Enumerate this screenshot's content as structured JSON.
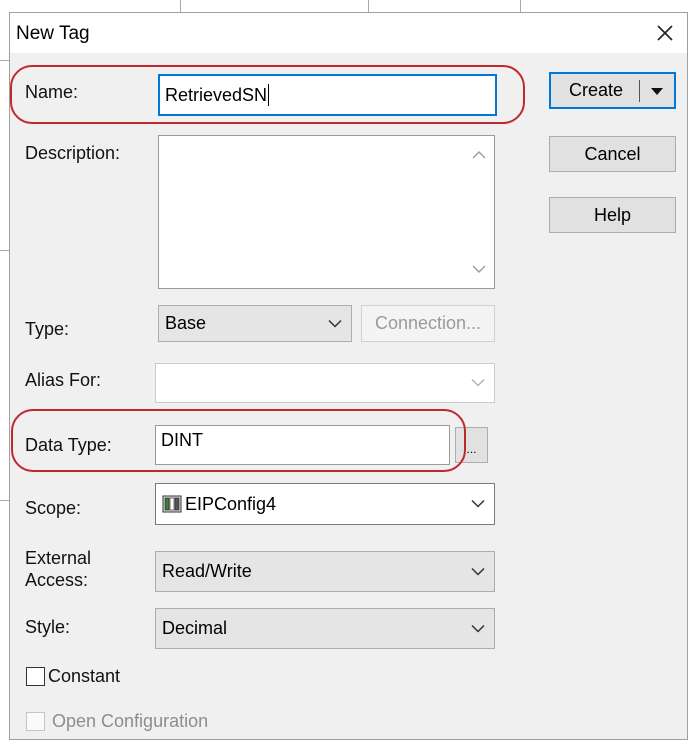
{
  "dialog": {
    "title": "New Tag",
    "close_glyph": "✕"
  },
  "name": {
    "label": "Name:",
    "value": "RetrievedSN"
  },
  "description": {
    "label": "Description:",
    "value": ""
  },
  "type": {
    "label": "Type:",
    "selected": "Base",
    "connection_button": "Connection..."
  },
  "alias_for": {
    "label": "Alias For:",
    "value": ""
  },
  "data_type": {
    "label": "Data Type:",
    "value": "DINT",
    "browse_button": "..."
  },
  "scope": {
    "label": "Scope:",
    "selected": "EIPConfig4",
    "icon": "controller-icon"
  },
  "external_access": {
    "label_line1": "External",
    "label_line2": "Access:",
    "selected": "Read/Write"
  },
  "style": {
    "label": "Style:",
    "selected": "Decimal"
  },
  "constant": {
    "label": "Constant",
    "checked": false
  },
  "open_configuration": {
    "label": "Open Configuration",
    "checked": false
  },
  "buttons": {
    "create": "Create",
    "cancel": "Cancel",
    "help": "Help"
  },
  "colors": {
    "highlight": "#c0282f",
    "focus_border": "#0078d7",
    "dialog_bg": "#f0f0f0"
  }
}
